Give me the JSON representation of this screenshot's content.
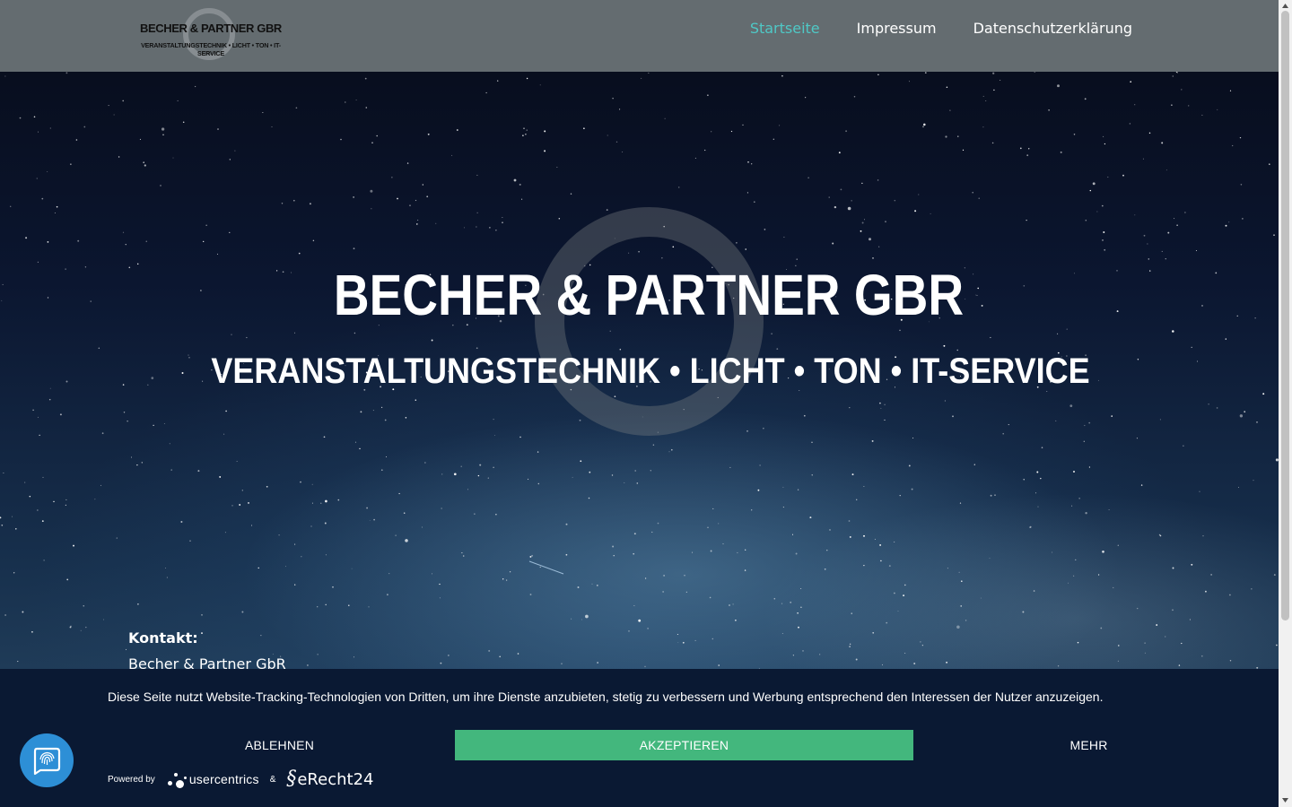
{
  "header": {
    "logo": {
      "title": "BECHER & PARTNER GBR",
      "subtitle": "VERANSTALTUNGSTECHNIK • LICHT • TON • IT-SERVICE"
    },
    "nav": [
      {
        "label": "Startseite",
        "active": true
      },
      {
        "label": "Impressum",
        "active": false
      },
      {
        "label": "Datenschutzerklärung",
        "active": false
      }
    ]
  },
  "hero": {
    "title": "BECHER & PARTNER GBR",
    "subtitle": "VERANSTALTUNGSTECHNIK • LICHT • TON • IT-SERVICE",
    "contact_heading": "Kontakt:",
    "contact_line": "Becher & Partner GbR"
  },
  "cookie_banner": {
    "message": "Diese Seite nutzt Website-Tracking-Technologien von Dritten, um ihre Dienste anzubieten, stetig zu verbessern und Werbung entsprechend den Interessen der Nutzer anzuzeigen.",
    "deny_label": "ABLEHNEN",
    "accept_label": "AKZEPTIEREN",
    "more_label": "MEHR",
    "powered_by": "Powered by",
    "usercentrics": "usercentrics",
    "ampersand": "&",
    "erecht_mark": "§",
    "erecht": "eRecht24"
  },
  "colors": {
    "header_bg": "#646c70",
    "nav_active": "#4fc8c6",
    "banner_bg": "#0a1933",
    "accept_bg": "#43b77d",
    "fab_bg": "#2d8fd6"
  },
  "icons": {
    "privacy_fab": "fingerprint-icon",
    "scroll_up": "caret-up-icon",
    "scroll_down": "caret-down-icon"
  }
}
